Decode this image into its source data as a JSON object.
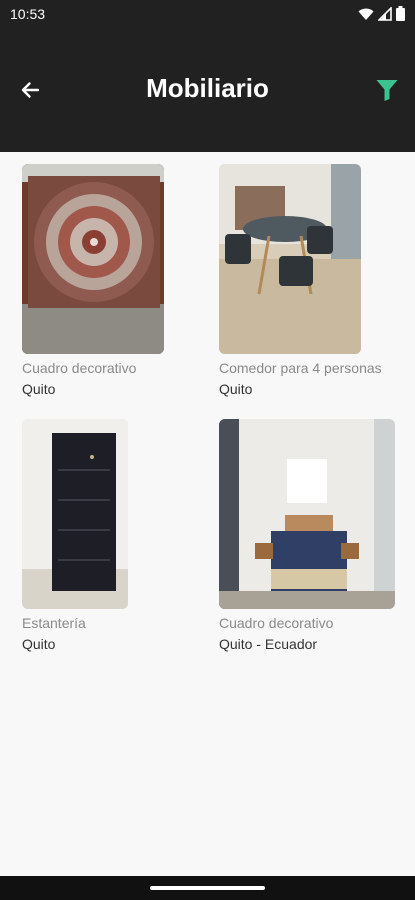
{
  "status_bar": {
    "time": "10:53"
  },
  "app_bar": {
    "title": "Mobiliario"
  },
  "colors": {
    "accent": "#3bc38f",
    "bar": "#212121"
  },
  "items": [
    {
      "title": "Cuadro decorativo",
      "location": "Quito"
    },
    {
      "title": "Comedor para 4 personas",
      "location": "Quito"
    },
    {
      "title": "Estantería",
      "location": "Quito"
    },
    {
      "title": "Cuadro decorativo",
      "location": "Quito - Ecuador"
    }
  ]
}
